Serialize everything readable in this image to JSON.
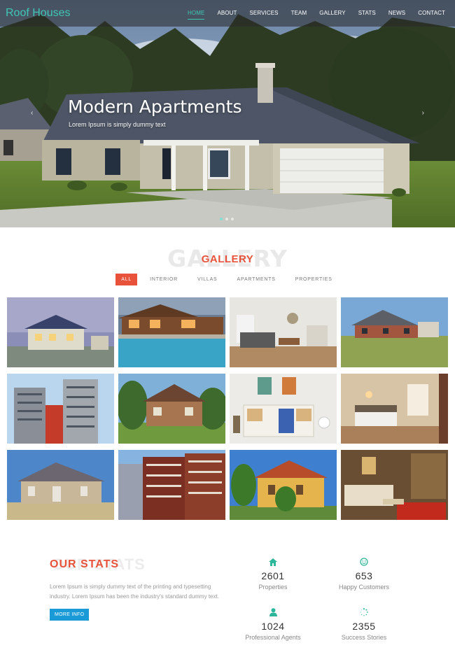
{
  "brand": "Roof Houses",
  "nav": [
    {
      "label": "HOME",
      "active": true
    },
    {
      "label": "ABOUT"
    },
    {
      "label": "SERVICES"
    },
    {
      "label": "TEAM"
    },
    {
      "label": "GALLERY"
    },
    {
      "label": "STATS"
    },
    {
      "label": "NEWS"
    },
    {
      "label": "CONTACT"
    }
  ],
  "hero": {
    "title": "Modern Apartments",
    "subtitle": "Lorem Ipsum is simply dummy text",
    "prev_icon": "chevron-left-icon",
    "next_icon": "chevron-right-icon",
    "prev_glyph": "‹",
    "next_glyph": "›",
    "slides": 3,
    "active_slide": 1
  },
  "gallery": {
    "heading": "GALLERY",
    "filters": [
      "ALL",
      "INTERIOR",
      "VILLAS",
      "APARTMENTS",
      "PROPERTIES"
    ]
  },
  "stats": {
    "heading": "OUR STATS",
    "text": "Lorem Ipsum is simply dummy text of the printing and typesetting industry. Lorem Ipsum has been the industry's standard dummy text.",
    "button": "MORE INFO",
    "items": [
      {
        "icon": "home-icon",
        "value": "2601",
        "label": "Properties"
      },
      {
        "icon": "smile-icon",
        "value": "653",
        "label": "Happy Customers"
      },
      {
        "icon": "user-icon",
        "value": "1024",
        "label": "Professional Agents"
      },
      {
        "icon": "spinner-icon",
        "value": "2355",
        "label": "Success Stories"
      }
    ]
  },
  "colors": {
    "accent": "#3ec7b5",
    "heading": "#e8523a",
    "button": "#1a9bd7",
    "stat_icon": "#2bb59a"
  }
}
